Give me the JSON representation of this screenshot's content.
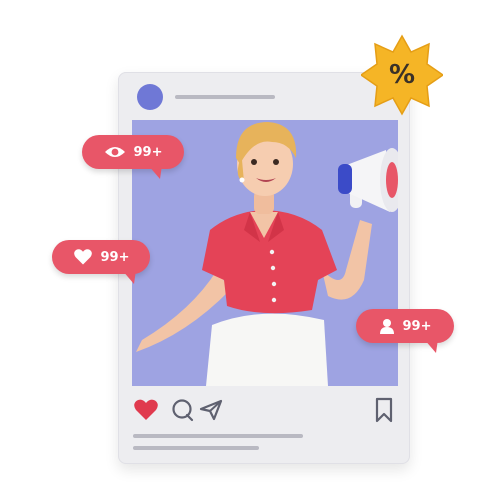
{
  "post": {
    "discount_symbol": "%"
  },
  "stats": {
    "views": {
      "icon": "eye-icon",
      "count": "99+"
    },
    "likes": {
      "icon": "heart-icon",
      "count": "99+"
    },
    "followers": {
      "icon": "user-icon",
      "count": "99+"
    }
  },
  "actions": {
    "like_icon": "heart-filled-icon",
    "comment_icon": "comment-icon",
    "share_icon": "send-icon",
    "save_icon": "bookmark-icon"
  },
  "colors": {
    "bubble": "#e85668",
    "photo_bg": "#9ea3e2",
    "avatar": "#6f78d6",
    "badge": "#f5b526",
    "like": "#e03a4e"
  }
}
